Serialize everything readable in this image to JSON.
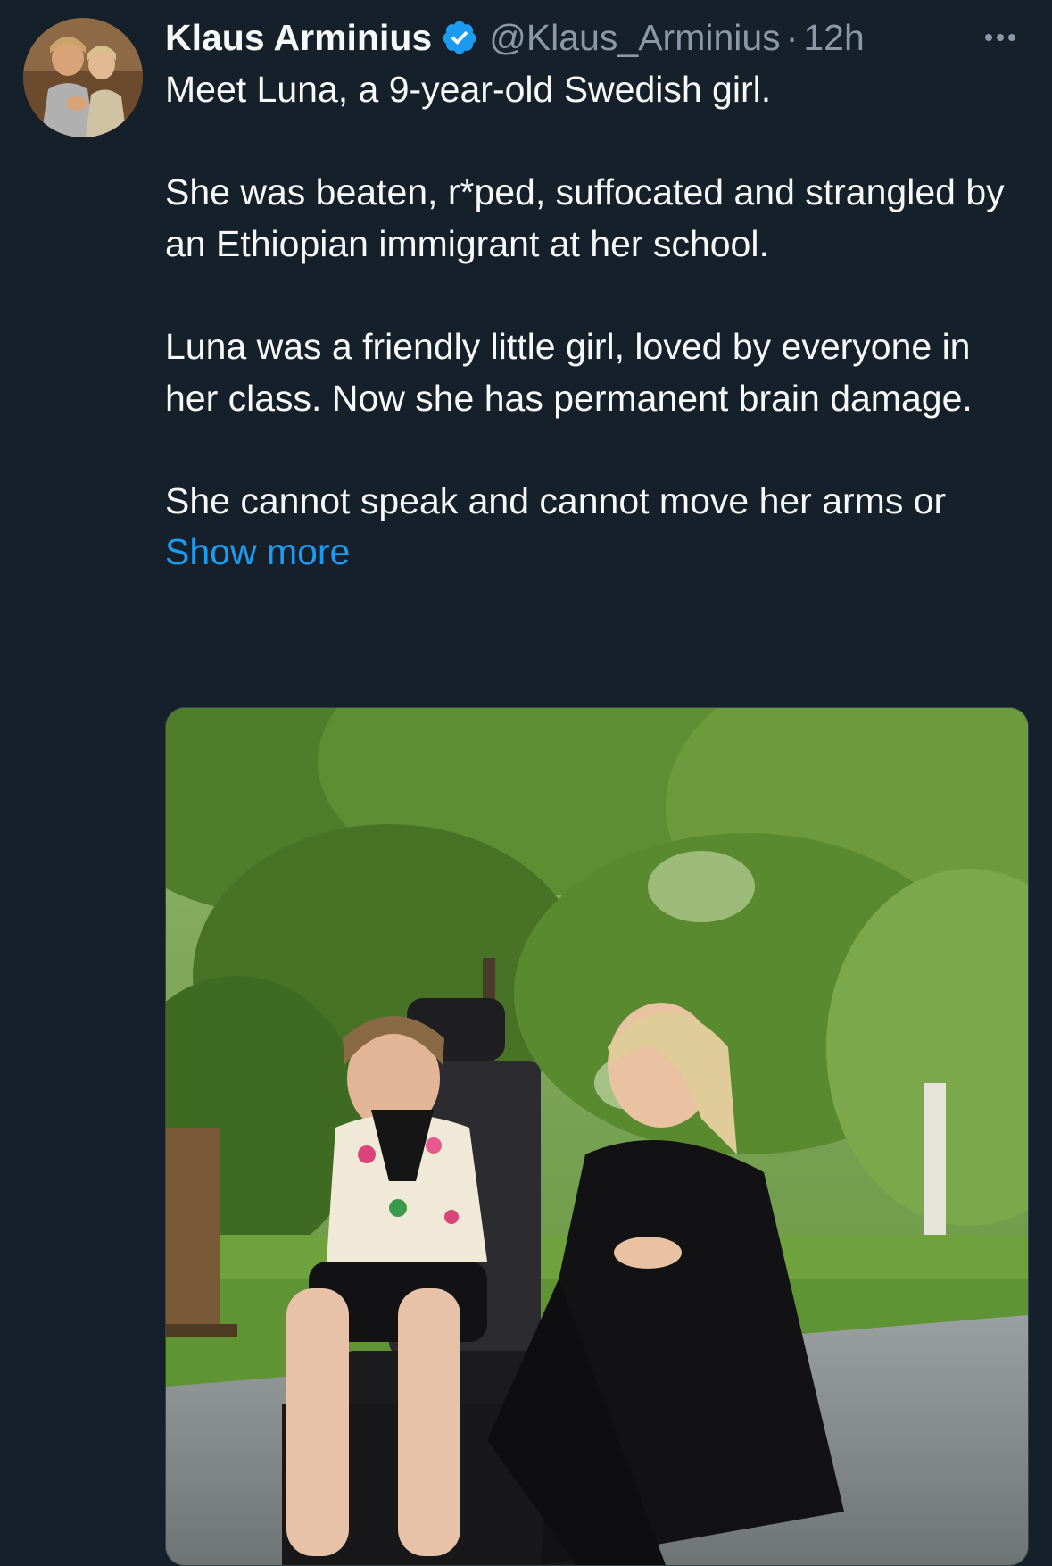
{
  "tweet": {
    "author": {
      "display_name": "Klaus Arminius",
      "handle": "@Klaus_Arminius",
      "verified": true,
      "avatar_icon": "avatar-painting"
    },
    "separator": "·",
    "time": "12h",
    "more_icon": "more-horizontal-icon",
    "text": {
      "p1": "Meet Luna, a 9-year-old Swedish girl.",
      "p2": "She was beaten, r*ped, suffocated and strangled by an Ethiopian immigrant at her school.",
      "p3": "Luna was a friendly little girl, loved by everyone in her class. Now she has permanent brain damage.",
      "p4": "She cannot speak and cannot move her arms or",
      "show_more": "Show more"
    },
    "media": {
      "type": "photo"
    }
  },
  "colors": {
    "background": "#15202b",
    "text_primary": "#f7f9f9",
    "text_secondary": "#8b98a5",
    "link": "#1d9bf0",
    "verified_badge": "#1d9bf0"
  }
}
